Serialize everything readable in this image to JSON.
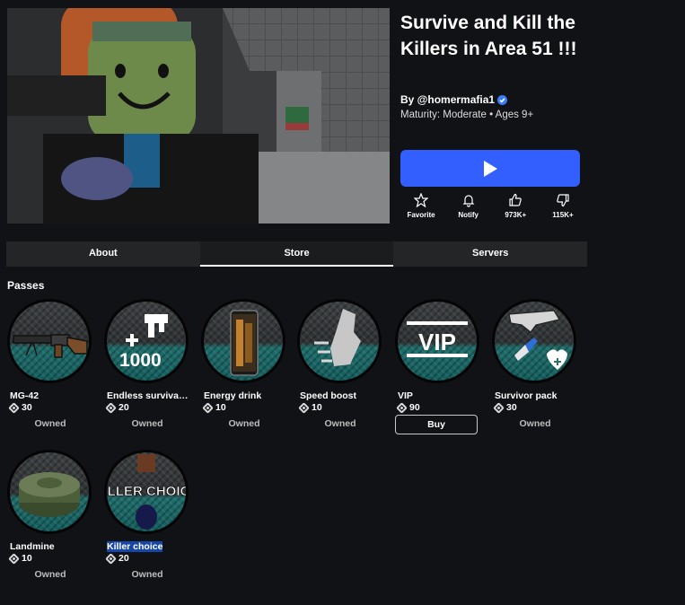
{
  "game": {
    "title": "Survive and Kill the Killers in Area 51 !!!",
    "creator": "By @homermafia1",
    "maturity": "Maturity: Moderate • Ages 9+",
    "thumbnail_icon": "game-thumbnail"
  },
  "play_button": {
    "icon": "play-icon",
    "color": "#335fff"
  },
  "actions": {
    "favorite": {
      "icon": "star-icon",
      "label": "Favorite"
    },
    "notify": {
      "icon": "bell-icon",
      "label": "Notify"
    },
    "like": {
      "icon": "thumbs-up-icon",
      "label": "973K+"
    },
    "dislike": {
      "icon": "thumbs-down-icon",
      "label": "115K+"
    }
  },
  "tabs": [
    {
      "label": "About",
      "active": false
    },
    {
      "label": "Store",
      "active": true
    },
    {
      "label": "Servers",
      "active": false
    }
  ],
  "passes": {
    "heading": "Passes",
    "items": [
      {
        "name": "MG-42",
        "price": "30",
        "status": "Owned",
        "icon": "machine-gun-icon"
      },
      {
        "name": "Endless survival ...",
        "price": "20",
        "status": "Owned",
        "icon": "uzi-1000-icon"
      },
      {
        "name": "Energy drink",
        "price": "10",
        "status": "Owned",
        "icon": "energy-drink-can-icon"
      },
      {
        "name": "Speed boost",
        "price": "10",
        "status": "Owned",
        "icon": "speed-boost-icon"
      },
      {
        "name": "VIP",
        "price": "90",
        "status": "Buy",
        "icon": "vip-sign-icon",
        "image_text": "VIP"
      },
      {
        "name": "Survivor pack",
        "price": "30",
        "status": "Owned",
        "icon": "survivor-pack-icon"
      },
      {
        "name": "Landmine",
        "price": "10",
        "status": "Owned",
        "icon": "landmine-icon"
      },
      {
        "name": "Killer choice",
        "price": "20",
        "status": "Owned",
        "icon": "killer-choice-icon",
        "image_text": "KILLER CHOICE"
      }
    ]
  }
}
